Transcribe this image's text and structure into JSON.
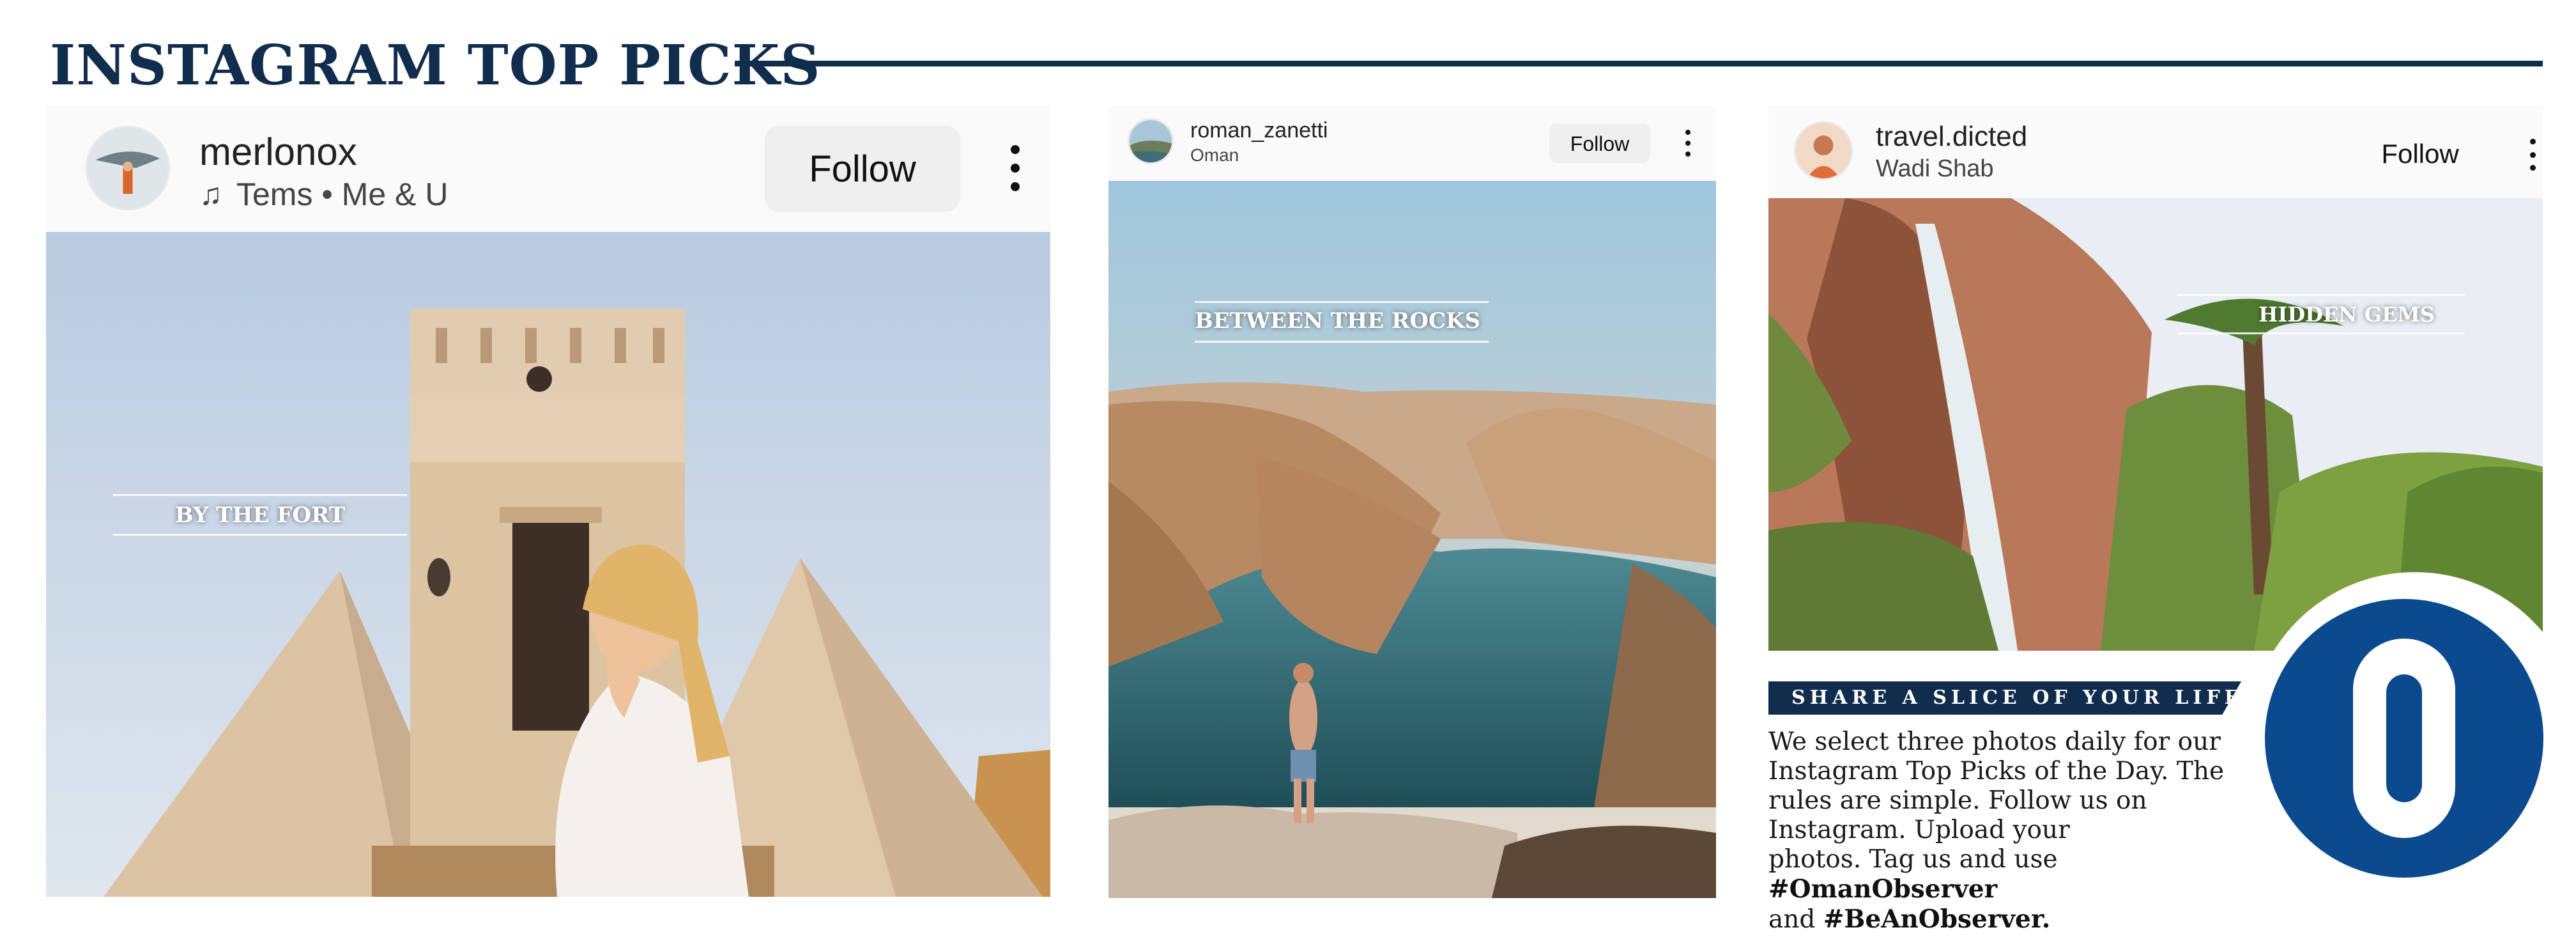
{
  "header": {
    "title": "INSTAGRAM TOP PICKS"
  },
  "posts": [
    {
      "username": "merlonox",
      "music_icon": "music-note-icon",
      "subtitle": "Tems • Me & U",
      "follow_label": "Follow",
      "more_icon": "more-vertical-icon",
      "caption": "BY THE FORT"
    },
    {
      "username": "roman_zanetti",
      "subtitle": "Oman",
      "follow_label": "Follow",
      "more_icon": "more-vertical-icon",
      "caption": "BETWEEN THE ROCKS"
    },
    {
      "username": "travel.dicted",
      "subtitle": "Wadi Shab",
      "follow_label": "Follow",
      "more_icon": "more-vertical-icon",
      "caption": "HIDDEN GEMS"
    }
  ],
  "info": {
    "banner": "SHARE A SLICE OF YOUR LIFE",
    "body_line1": "We select three photos daily for our",
    "body_line2": "Instagram Top Picks of the Day. The",
    "body_line3": "rules are simple. Follow us on",
    "body_line4": "Instagram. Upload your",
    "body_line5_pre": "photos. Tag us and use ",
    "hashtag1": "#OmanObserver",
    "body_line6_pre": "and ",
    "hashtag2": "#BeAnObserver."
  },
  "logo": {
    "letter": "O",
    "color": "#0b4a8f"
  },
  "colors": {
    "heading": "#112d4e",
    "logo_blue": "#0b4a8f"
  }
}
